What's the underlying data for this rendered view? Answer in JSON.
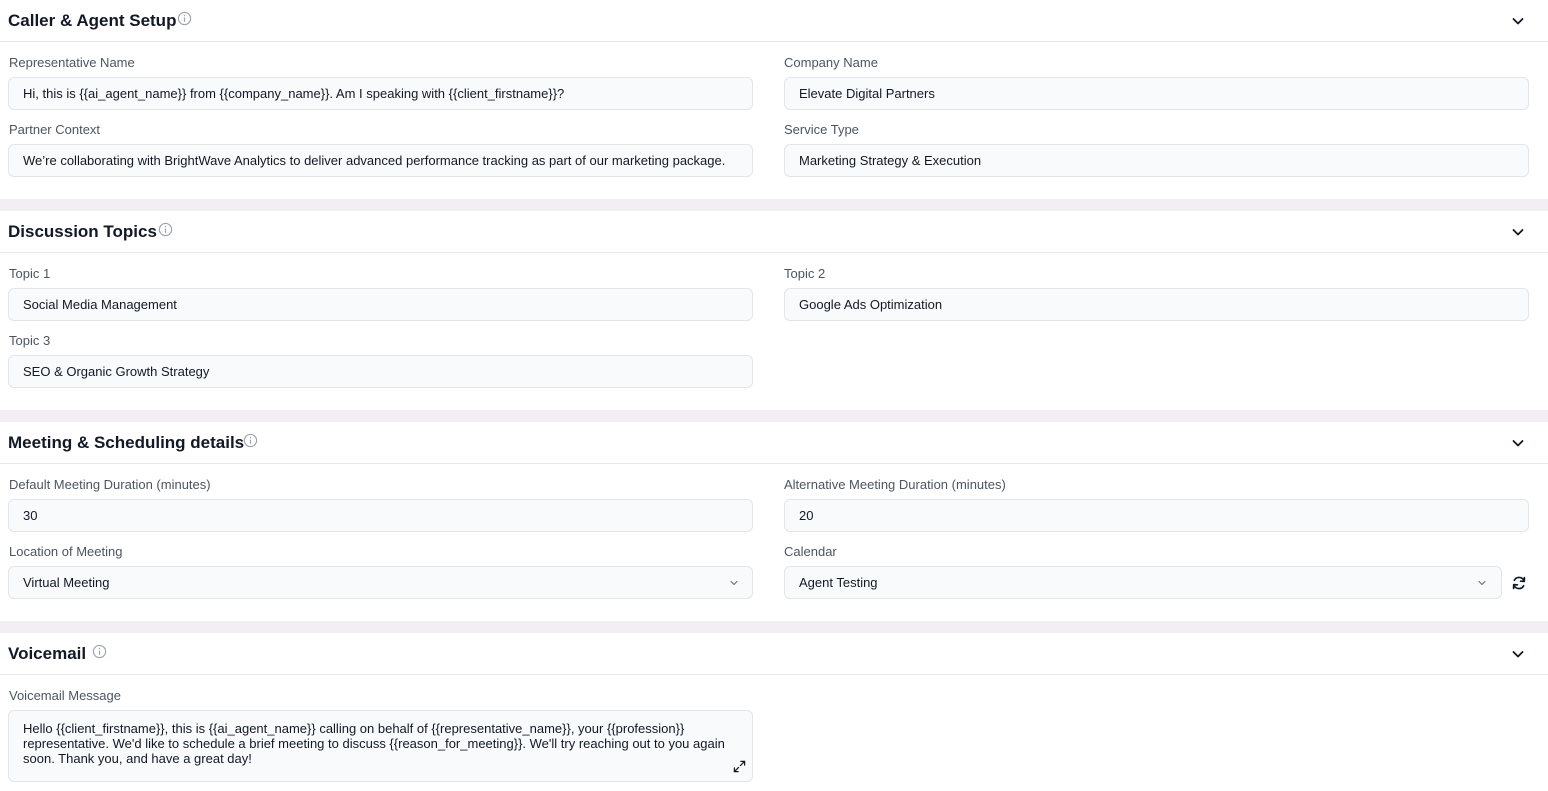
{
  "sections": {
    "caller": {
      "title": "Caller & Agent Setup",
      "fields": {
        "rep_name": {
          "label": "Representative Name",
          "value": "Hi, this is {{ai_agent_name}} from {{company_name}}. Am I speaking with {{client_firstname}}?"
        },
        "company_name": {
          "label": "Company Name",
          "value": "Elevate Digital Partners"
        },
        "partner_context": {
          "label": "Partner Context",
          "value": "We’re collaborating with BrightWave Analytics to deliver advanced performance tracking as part of our marketing package."
        },
        "service_type": {
          "label": "Service Type",
          "value": "Marketing Strategy & Execution"
        }
      }
    },
    "topics": {
      "title": "Discussion Topics",
      "fields": {
        "topic1": {
          "label": "Topic 1",
          "value": "Social Media Management"
        },
        "topic2": {
          "label": "Topic 2",
          "value": "Google Ads Optimization"
        },
        "topic3": {
          "label": "Topic 3",
          "value": "SEO & Organic Growth Strategy"
        }
      }
    },
    "meeting": {
      "title": "Meeting & Scheduling details",
      "fields": {
        "default_duration": {
          "label": "Default Meeting Duration (minutes)",
          "value": "30"
        },
        "alt_duration": {
          "label": "Alternative Meeting Duration (minutes)",
          "value": "20"
        },
        "location": {
          "label": "Location of Meeting",
          "value": "Virtual Meeting"
        },
        "calendar": {
          "label": "Calendar",
          "value": "Agent Testing"
        }
      }
    },
    "voicemail": {
      "title": "Voicemail",
      "fields": {
        "message": {
          "label": "Voicemail Message",
          "value": "Hello {{client_firstname}}, this is {{ai_agent_name}} calling on behalf of {{representative_name}}, your {{profession}} representative. We'd like to schedule a brief meeting to discuss {{reason_for_meeting}}. We'll try reaching out to you again soon. Thank you, and have a great day!"
        }
      }
    }
  },
  "icons": {
    "info": "info-circle-icon",
    "chevron": "chevron-down-icon",
    "select": "select-chevron-icon",
    "refresh": "refresh-icon",
    "expand": "expand-icon"
  },
  "colors": {
    "page_bg": "#f3eef3",
    "field_bg": "#f9fafb",
    "border": "#e2e5ea",
    "label": "#4b5563",
    "icon": "#9ca3af"
  }
}
